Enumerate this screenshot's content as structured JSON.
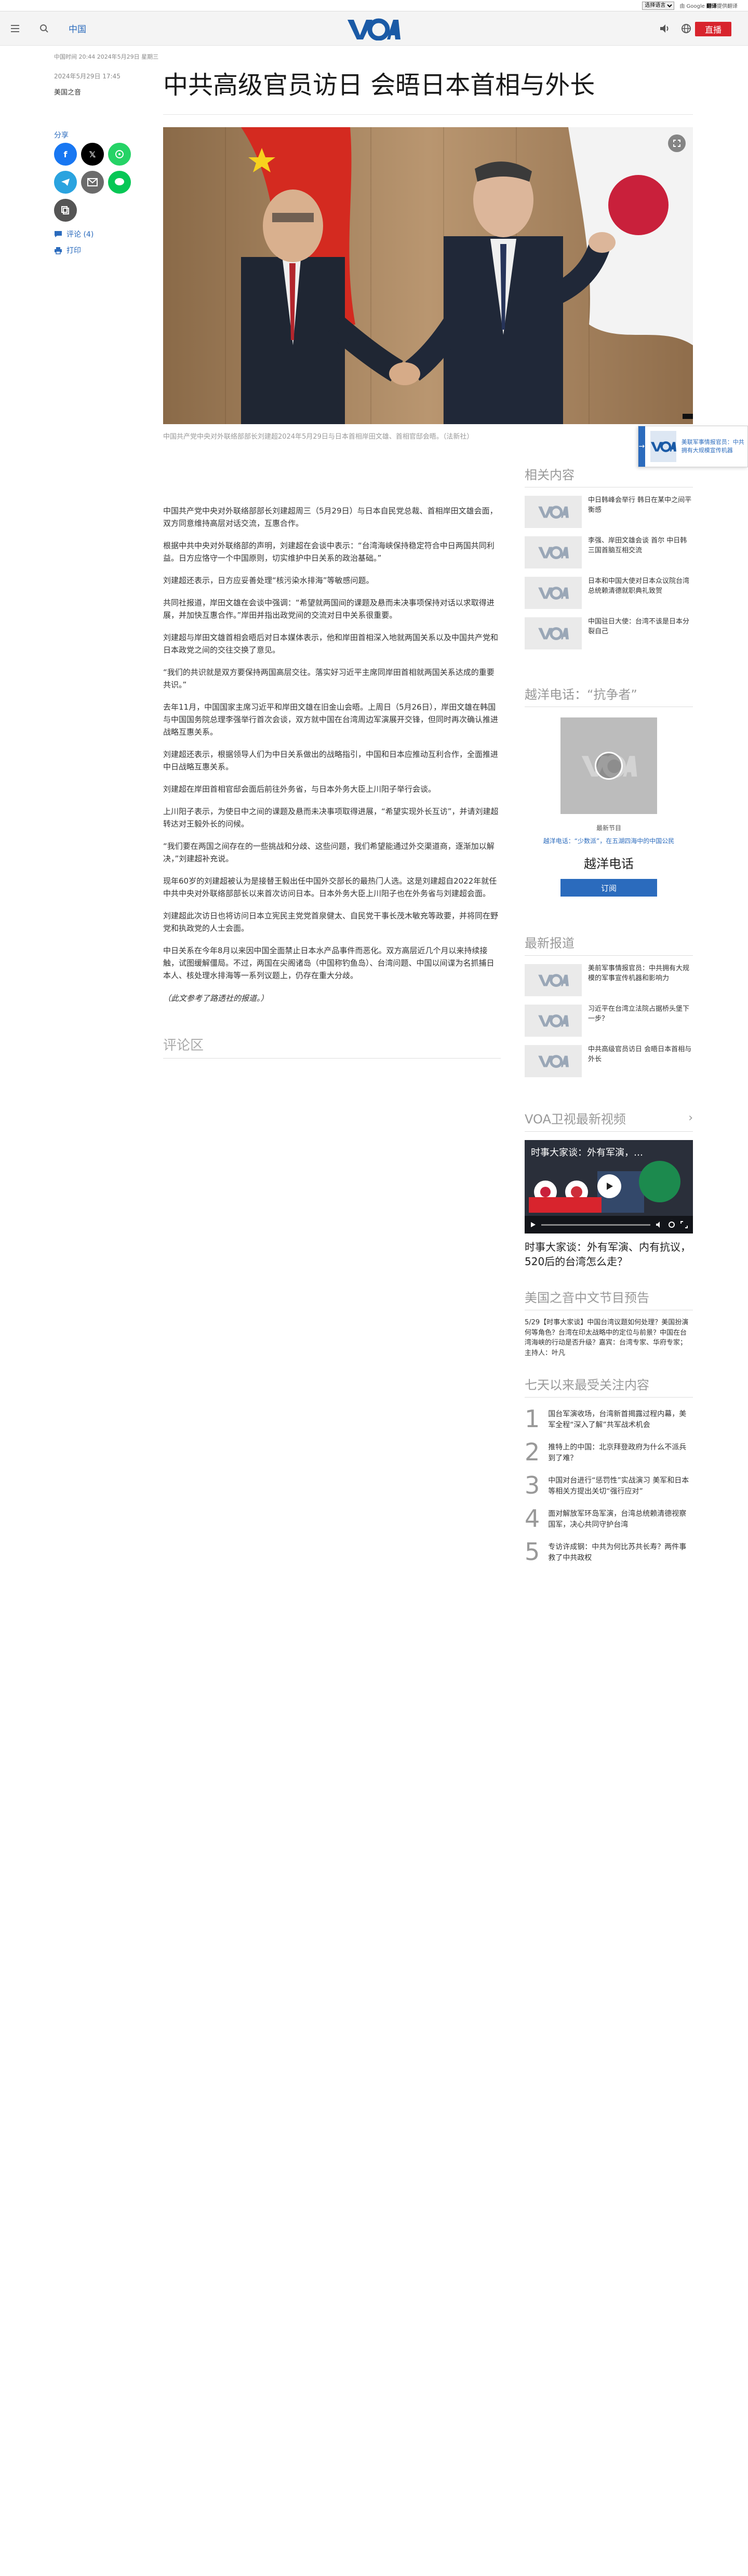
{
  "util": {
    "language_select": "选择语言",
    "google_prefix": "由 Google",
    "google_brand": "翻译",
    "google_suffix": "提供翻译"
  },
  "header": {
    "section": "中国",
    "live_label": "直播",
    "logo_text": "VOA"
  },
  "dateline_top": "中国时间 20:44 2024年5月29日 星期三",
  "meta": {
    "date": "2024年5月29日 17:45",
    "author": "美国之音"
  },
  "share": {
    "title": "分享",
    "comments_label": "评论 (4)",
    "print_label": "打印"
  },
  "headline": "中共高级官员访日 会晤日本首相与外长",
  "caption": "中国共产党中央对外联络部部长刘建超2024年5月29日与日本首相岸田文雄、首相官邸会晤。（法新社）",
  "article": {
    "paragraphs": [
      "中国共产党中央对外联络部部长刘建超周三（5月29日）与日本自民党总裁、首相岸田文雄会面，双方同意维持高层对话交流，互惠合作。",
      "根据中共中央对外联络部的声明，刘建超在会谈中表示：“台湾海峡保持稳定符合中日两国共同利益。日方应恪守一个中国原则，切实维护中日关系的政治基础。”",
      "刘建超还表示，日方应妥善处理“核污染水排海”等敏感问题。",
      "共同社报道，岸田文雄在会谈中强调：“希望就两国间的课题及悬而未决事项保持对话以求取得进展，并加快互惠合作。”岸田并指出政党间的交流对日中关系很重要。",
      "刘建超与岸田文雄首相会晤后对日本媒体表示，他和岸田首相深入地就两国关系以及中国共产党和日本政党之间的交往交换了意见。",
      "“我们的共识就是双方要保持两国高层交往。落实好习近平主席同岸田首相就两国关系达成的重要共识。”",
      "去年11月，中国国家主席习近平和岸田文雄在旧金山会晤。上周日（5月26日），岸田文雄在韩国与中国国务院总理李强举行首次会谈，双方就中国在台湾周边军演展开交锋，但同时再次确认推进战略互惠关系。",
      "刘建超还表示，根据领导人们为中日关系做出的战略指引，中国和日本应推动互利合作，全面推进中日战略互惠关系。",
      "刘建超在岸田首相官邸会面后前往外务省，与日本外务大臣上川阳子举行会谈。",
      "上川阳子表示，为使日中之间的课题及悬而未决事项取得进展，“希望实现外长互访”，并请刘建超转达对王毅外长的问候。",
      "“我们要在两国之间存在的一些挑战和分歧、这些问题，我们希望能通过外交渠道商，逐渐加以解决，”刘建超补充说。",
      "现年60岁的刘建超被认为是接替王毅出任中国外交部长的最热门人选。这是刘建超自2022年就任中共中央对外联络部部长以来首次访问日本。日本外务大臣上川阳子也在外务省与刘建超会面。",
      "刘建超此次访日也将访问日本立宪民主党党首泉健太、自民党干事长茂木敏充等政要，并将同在野党和执政党的人士会面。",
      "中日关系在今年8月以来因中国全面禁止日本水产品事件而恶化。双方高层近几个月以来持续接触，试图缓解僵局。不过，两国在尖阁诸岛（中国称钓鱼岛）、台湾问题、中国以间谍为名抓捕日本人、核处理水排海等一系列议题上，仍存在重大分歧。"
    ],
    "source_note": "（此文参考了路透社的报道。）"
  },
  "comments_heading": "评论区",
  "sidebar": {
    "related_title": "相关内容",
    "related": [
      "中日韩峰会举行 韩日在某中之间平衡感",
      "李强、岸田文雄会谈 首尔 中日韩三国首脑互相交流",
      "日本和中国大使对日本众议院台湾总统赖清德就职典礼致贺",
      "中国驻日大使：台湾不该是日本分裂自己"
    ],
    "radio_title": "越洋电话：“抗争者”",
    "program_label": "最新节目",
    "program_sub": "越洋电话：“少数派”，在五湖四海中的中国公民",
    "program_name": "越洋电话",
    "subscribe_label": "订阅",
    "latest_title": "最新报道",
    "latest": [
      "美前军事情报官员：中共拥有大规模的军事宣传机器和影响力",
      "习近平在台湾立法院占据桥头堡下一步？",
      "中共高级官员访日 会晤日本首相与外长"
    ],
    "tv_title": "VOA卫视最新视频",
    "video_overlay_title": "时事大家谈：外有军演，…",
    "video_headline": "时事大家谈：外有军演、内有抗议，520后的台湾怎么走？",
    "radio_preview_title": "美国之音中文节目预告",
    "radio_preview_text": "5/29【时事大家谈】中国台湾议题如何处理？美国扮演何等角色？台湾在印太战略中的定位与前景？中国在台湾海峡的行动是否升级？嘉宾：台湾专家、华府专家；主持人：叶凡",
    "popular_title": "七天以来最受关注内容",
    "popular": [
      "国台军演收场，台湾新首揭露过程内幕，美军全程“深入了解”共军战术机会",
      "推特上的中国：北京拜登政府为什么不派兵到了难？",
      "中国对台进行“惩罚性”实战演习 美军和日本等相关方提出关切“强行应对”",
      "面对解放军环岛军演，台湾总统赖清德视察国军，决心共同守护台湾",
      "专访许成钢：中共为何比苏共长寿？两件事救了中共政权"
    ],
    "promo_text": "美联军事情报官员：中共拥有大规模宣传机器"
  }
}
